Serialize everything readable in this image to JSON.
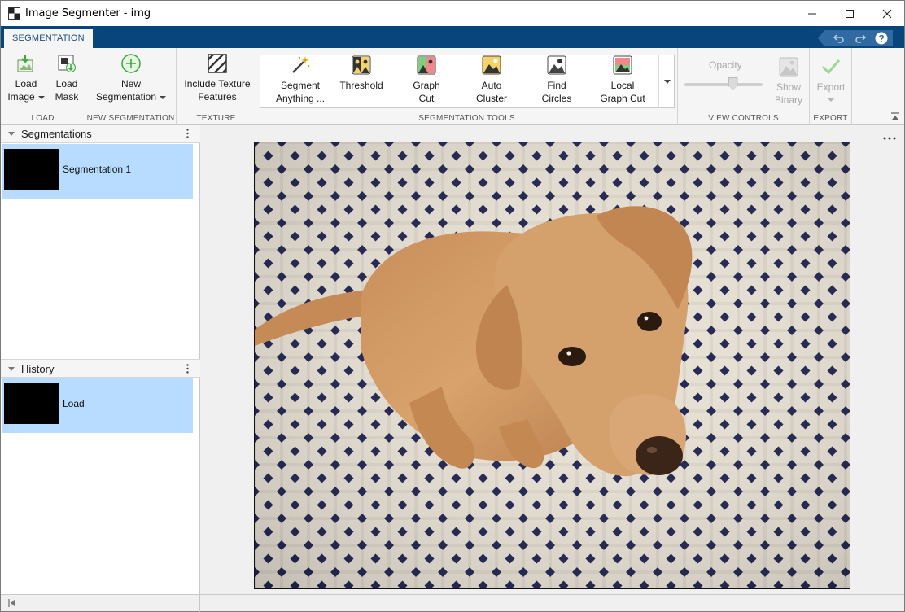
{
  "window": {
    "title": "Image Segmenter - img"
  },
  "tabs": [
    {
      "label": "SEGMENTATION",
      "active": true
    }
  ],
  "ribbon": {
    "load": {
      "label": "LOAD",
      "load_image_l1": "Load",
      "load_image_l2": "Image",
      "load_mask_l1": "Load",
      "load_mask_l2": "Mask"
    },
    "new_segmentation": {
      "label": "NEW SEGMENTATION",
      "btn_l1": "New",
      "btn_l2": "Segmentation"
    },
    "texture": {
      "label": "TEXTURE",
      "btn_l1": "Include Texture",
      "btn_l2": "Features"
    },
    "tools": {
      "label": "SEGMENTATION TOOLS",
      "items": [
        {
          "l1": "Segment",
          "l2": "Anything ..."
        },
        {
          "l1": "Threshold",
          "l2": ""
        },
        {
          "l1": "Graph",
          "l2": "Cut"
        },
        {
          "l1": "Auto",
          "l2": "Cluster"
        },
        {
          "l1": "Find",
          "l2": "Circles"
        },
        {
          "l1": "Local",
          "l2": "Graph Cut"
        }
      ]
    },
    "view_controls": {
      "label": "VIEW CONTROLS",
      "opacity_label": "Opacity",
      "opacity_value": 0.62,
      "show_binary_l1": "Show",
      "show_binary_l2": "Binary"
    },
    "export": {
      "label": "EXPORT",
      "btn_label": "Export"
    }
  },
  "panels": {
    "segmentations": {
      "title": "Segmentations",
      "items": [
        {
          "label": "Segmentation 1",
          "selected": true
        }
      ]
    },
    "history": {
      "title": "History",
      "items": [
        {
          "label": "Load",
          "selected": true
        }
      ]
    }
  },
  "colors": {
    "tab_strip": "#07457a",
    "selection": "#b7dcff",
    "accent_green": "#3aa83a"
  }
}
